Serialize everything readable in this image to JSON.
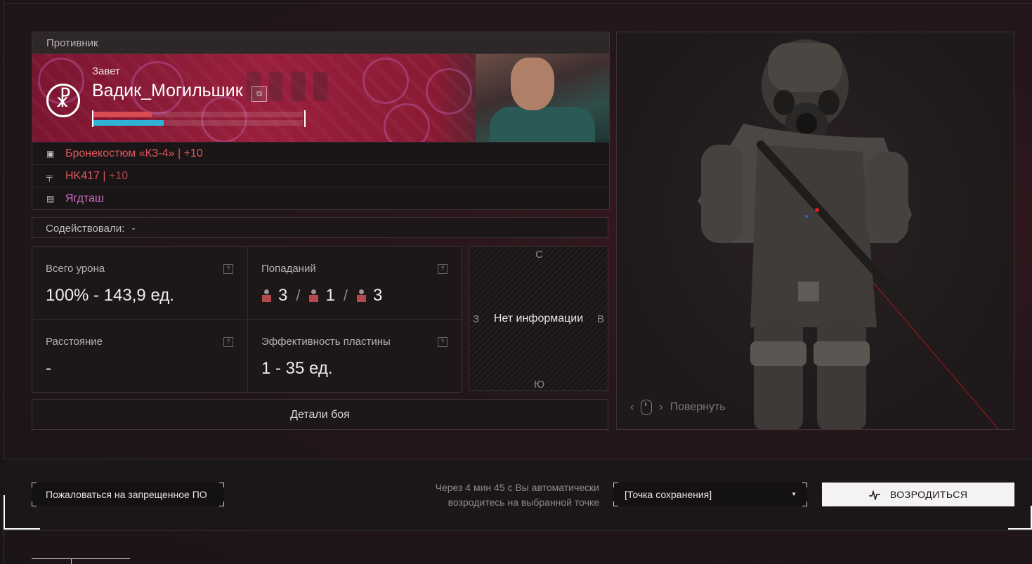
{
  "enemy": {
    "header": "Противник",
    "faction": "Завет",
    "name": "Вадик_Могильшик",
    "health_fraction": 0.28,
    "armor_fraction": 0.335,
    "colors": {
      "health": "#d94a55",
      "armor": "#2fb2d6"
    },
    "equipment": [
      {
        "icon": "armor-icon",
        "name": "Бронекостюм «КЗ-4»",
        "sep": " | ",
        "upgrade": "+10"
      },
      {
        "icon": "rifle-icon",
        "name": "HK417",
        "sep": " | ",
        "upgrade": "+10"
      },
      {
        "icon": "backpack-icon",
        "name": "Ягдташ"
      }
    ]
  },
  "assist": {
    "label": "Содействовали:",
    "value": "-"
  },
  "stats": {
    "total_damage": {
      "label": "Всего урона",
      "value": "100% - 143,9 ед."
    },
    "hits": {
      "label": "Попаданий",
      "head": "3",
      "torso": "1",
      "legs": "3",
      "separator": "/"
    },
    "distance": {
      "label": "Расстояние",
      "value": "-"
    },
    "plate_efficiency": {
      "label": "Эффективность пластины",
      "value": "1 - 35 ед."
    },
    "help_glyph": "?"
  },
  "compass": {
    "north": "С",
    "south": "Ю",
    "west": "З",
    "east": "В",
    "center": "Нет информации"
  },
  "details_button": "Детали боя",
  "model_view": {
    "rotate_hint": "Повернуть"
  },
  "footer": {
    "report_button": "Пожаловаться на запрещенное ПО",
    "respawn_note_line1": "Через 4 мин 45 с Вы автоматически",
    "respawn_note_line2": "возродитесь на выбранной точке",
    "spawn_point": "[Точка сохранения]",
    "respawn_button": "ВОЗРОДИТЬСЯ"
  }
}
